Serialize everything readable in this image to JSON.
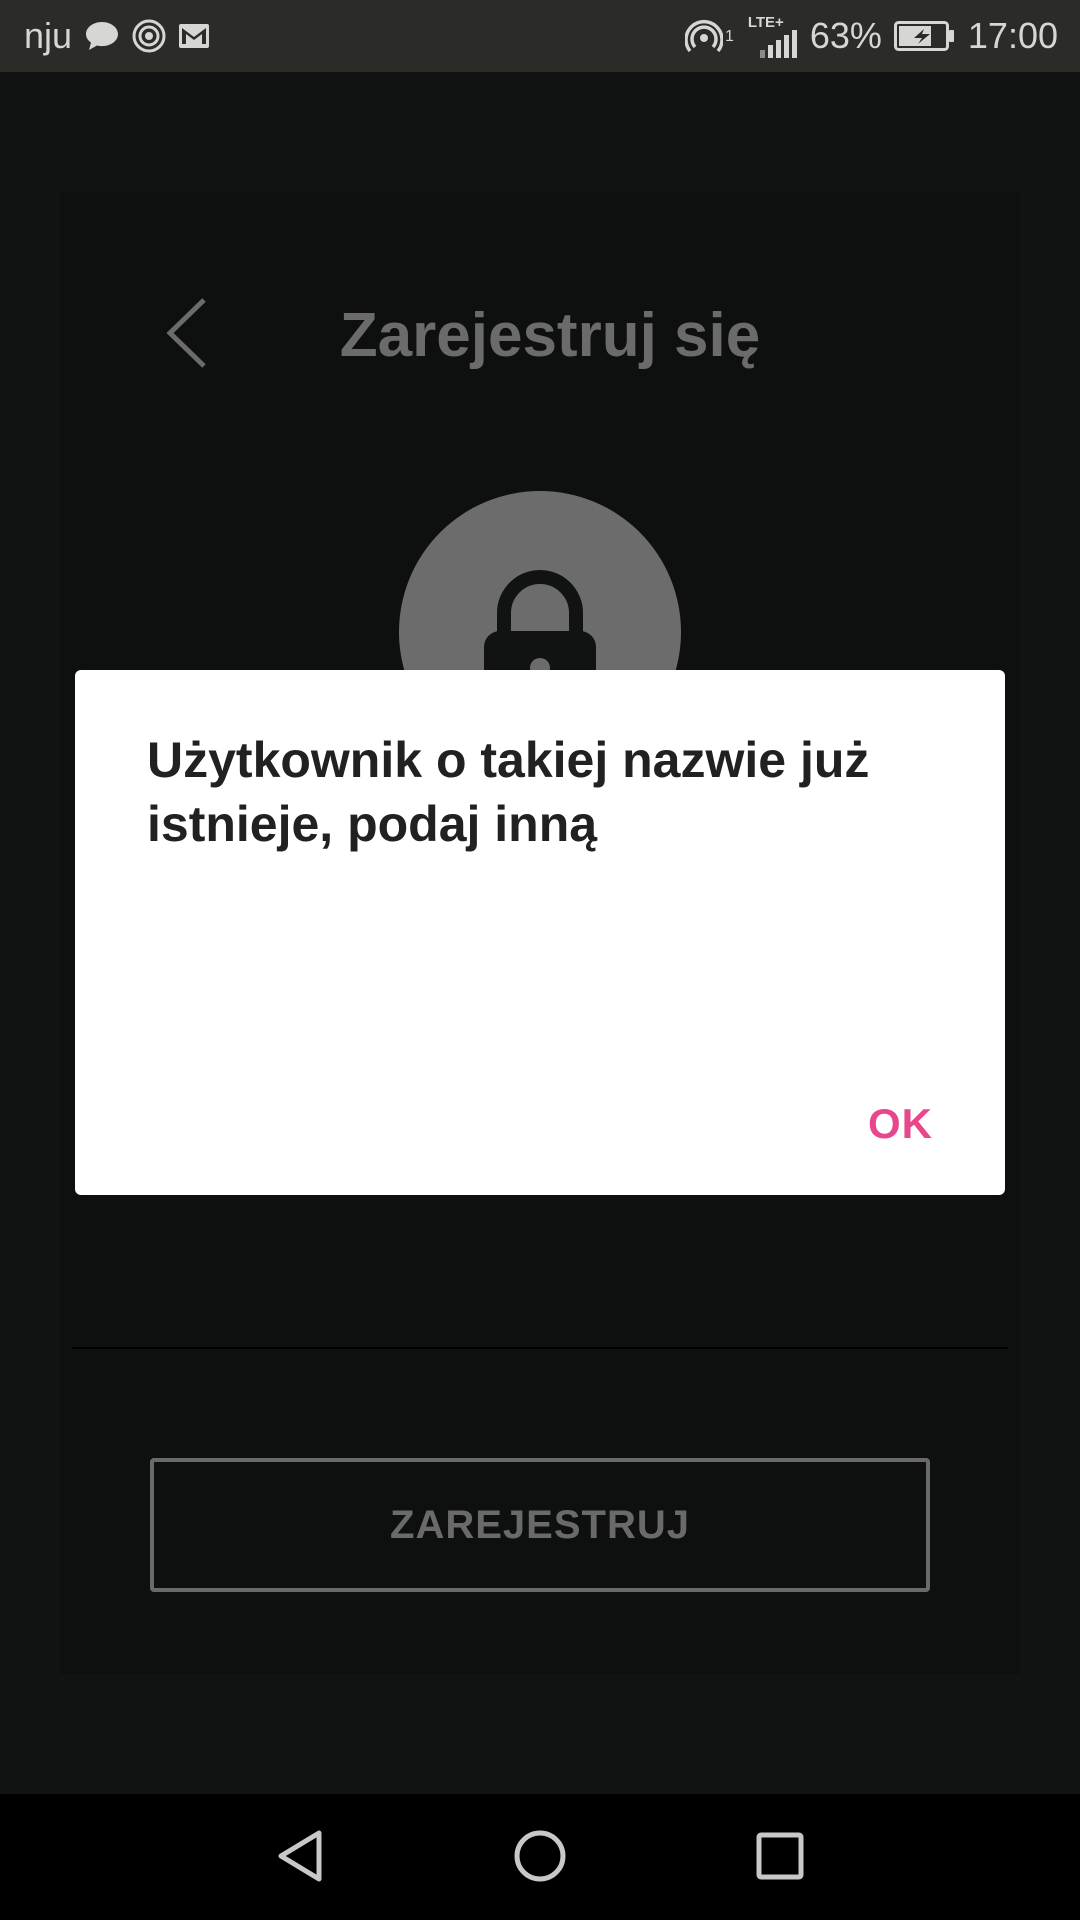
{
  "status_bar": {
    "carrier": "nju",
    "sim_index": "1",
    "network": "LTE+",
    "battery": "63%",
    "time": "17:00",
    "icons": [
      "chat-bubble-icon",
      "hotspot-icon",
      "gmail-icon",
      "hotspot-icon",
      "signal-icon",
      "battery-charging-icon"
    ]
  },
  "register_screen": {
    "title": "Zarejestruj się",
    "register_button_label": "ZAREJESTRUJ"
  },
  "dialog": {
    "message": "Użytkownik o takiej nazwie już istnieje, podaj inną",
    "ok_label": "OK"
  },
  "colors": {
    "accent": "#e8488b",
    "overlay_bg": "#111313",
    "dialog_bg": "#ffffff",
    "status_bar_bg": "#2b2b28"
  },
  "nav_bar": {
    "icons": [
      "back-triangle-icon",
      "home-circle-icon",
      "recents-square-icon"
    ]
  }
}
